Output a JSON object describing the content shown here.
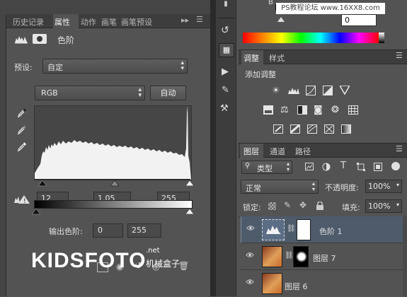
{
  "properties_panel": {
    "tabs": [
      "历史记录",
      "属性",
      "动作",
      "画笔",
      "画笔预设"
    ],
    "active_tab": "属性",
    "title": "色阶",
    "preset_label": "预设:",
    "preset_value": "自定",
    "channel_value": "RGB",
    "auto_button": "自动",
    "input_black": "12",
    "input_gamma": "1.05",
    "input_white": "255",
    "output_label": "输出色阶:",
    "output_black": "0",
    "output_white": "255"
  },
  "color_panel": {
    "label_b": "B",
    "value": "0"
  },
  "adjustments_panel": {
    "tabs": [
      "调整",
      "样式"
    ],
    "title": "添加调整"
  },
  "layers_panel": {
    "tabs": [
      "图层",
      "通道",
      "路径"
    ],
    "filter_value": "类型",
    "blend_mode": "正常",
    "opacity_label": "不透明度:",
    "opacity_value": "100%",
    "lock_label": "锁定:",
    "fill_label": "填充:",
    "fill_value": "100%",
    "layers": [
      {
        "name": "色阶 1"
      },
      {
        "name": "图层 7"
      },
      {
        "name": "图层 6"
      }
    ]
  },
  "watermarks": {
    "top": "PS教程论坛 www.16XX8.com",
    "brand": "KIDSFOTO",
    "brand_net": ".net",
    "brand_cn": "机械盒子"
  },
  "colors": {
    "panel_bg": "#535353",
    "dark_bg": "#3c3c3c",
    "selected_layer": "#4d5b6b"
  }
}
